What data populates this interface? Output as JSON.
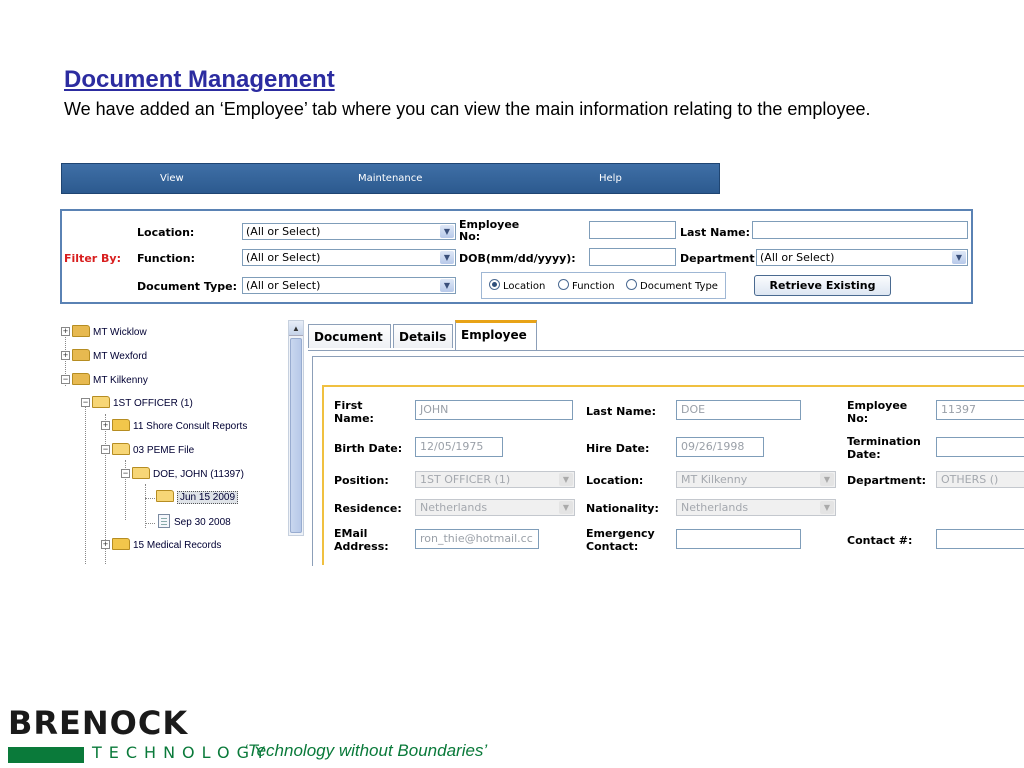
{
  "slide": {
    "title": "Document Management",
    "description": "We have added an ‘Employee’ tab where you can view the main information relating to the employee."
  },
  "menubar": {
    "items": [
      "View",
      "Maintenance",
      "Help"
    ]
  },
  "filter": {
    "filter_by_label": "Filter By:",
    "location_label": "Location:",
    "location_value": "(All or Select)",
    "function_label": "Function:",
    "function_value": "(All or Select)",
    "doctype_label": "Document Type:",
    "doctype_value": "(All or Select)",
    "employee_no_label_1": "Employee",
    "employee_no_label_2": "No:",
    "employee_no_value": "",
    "dob_label": "DOB(mm/dd/yyyy):",
    "dob_value": "",
    "last_name_label": "Last Name:",
    "last_name_value": "",
    "department_label": "Department",
    "department_value": "(All or Select)",
    "radio": {
      "options": [
        "Location",
        "Function",
        "Document Type"
      ],
      "selected": "Location"
    },
    "retrieve_button": "Retrieve Existing"
  },
  "tree": {
    "nodes": [
      "MT Wicklow",
      "MT Wexford",
      "MT Kilkenny",
      "1ST OFFICER (1)",
      "11 Shore Consult Reports",
      "03 PEME File",
      "DOE, JOHN (11397)",
      "Jun 15 2009",
      "Sep 30 2008",
      "15 Medical Records"
    ],
    "selected": "Jun 15 2009"
  },
  "tabs": {
    "items": [
      "Document",
      "Details",
      "Employee"
    ],
    "active": "Employee"
  },
  "employee": {
    "first_name_label_1": "First",
    "first_name_label_2": "Name:",
    "first_name": "JOHN",
    "last_name_label": "Last Name:",
    "last_name": "DOE",
    "employee_no_label_1": "Employee",
    "employee_no_label_2": "No:",
    "employee_no": "11397",
    "birth_date_label": "Birth Date:",
    "birth_date": "12/05/1975",
    "hire_date_label": "Hire Date:",
    "hire_date": "09/26/1998",
    "termination_label_1": "Termination",
    "termination_label_2": "Date:",
    "termination_date": "",
    "position_label": "Position:",
    "position": "1ST OFFICER (1)",
    "location_label": "Location:",
    "location": "MT Kilkenny",
    "department_label": "Department:",
    "department": "OTHERS ()",
    "residence_label": "Residence:",
    "residence": "Netherlands",
    "nationality_label": "Nationality:",
    "nationality": "Netherlands",
    "email_label_1": "EMail",
    "email_label_2": "Address:",
    "email": "ron_thie@hotmail.cc",
    "emergency_label_1": "Emergency",
    "emergency_label_2": "Contact:",
    "emergency_contact": "",
    "contact_label": "Contact #:",
    "contact": ""
  },
  "footer": {
    "logo_top": "BRENOCK",
    "logo_bottom": "TECHNOLOGY",
    "tagline": "‘Technology without Boundaries’"
  },
  "colors": {
    "title": "#2c2ca0",
    "menubar": "#2c5a8f",
    "filter_red": "#d81e1e",
    "active_tab": "#e8a317",
    "brand_green": "#0a7a3a"
  },
  "icons": [
    "folder-icon",
    "document-icon",
    "expand-icon",
    "collapse-icon",
    "dropdown-arrow-icon",
    "scroll-up-icon"
  ]
}
